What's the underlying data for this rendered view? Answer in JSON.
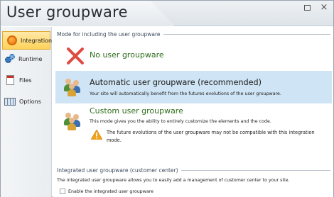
{
  "window": {
    "title": "User groupware",
    "maximize_label": "□",
    "close_label": "×"
  },
  "sidebar": {
    "items": [
      {
        "label": "Integration",
        "active": true,
        "icon": "integration-icon"
      },
      {
        "label": "Runtime",
        "active": false,
        "icon": "gears-icon"
      },
      {
        "label": "Files",
        "active": false,
        "icon": "file-icon"
      },
      {
        "label": "Options",
        "active": false,
        "icon": "options-icon"
      }
    ]
  },
  "main": {
    "mode_section_title": "Mode for including the user groupware",
    "options": [
      {
        "title": "No user groupware",
        "description": "",
        "selected": false,
        "icon": "red-x-icon"
      },
      {
        "title": "Automatic user groupware (recommended)",
        "description": "Your site will automatically benefit from the futures evolutions of the user groupware.",
        "selected": true,
        "icon": "users-group-icon"
      },
      {
        "title": "Custom user groupware",
        "description": "This mode gives you the ability to entirely customize the elements and the code.",
        "selected": false,
        "icon": "users-group-icon",
        "warning_line1": "The future evolutions of the user groupware may not be compatible with this integration",
        "warning_line2": "mode."
      }
    ],
    "integrated_section_title": "Integrated user groupware (customer center)",
    "integrated_description": "The integrated user groupware allows you to easily add a management of customer center to your site.",
    "enable_checkbox_label": "Enable the integrated user groupware",
    "enable_checked": false
  },
  "colors": {
    "accent_active": "#ffd25a",
    "selected_row": "#cfe4f4",
    "option_title_green": "#2f6d1c",
    "error_red": "#e04a3f"
  }
}
